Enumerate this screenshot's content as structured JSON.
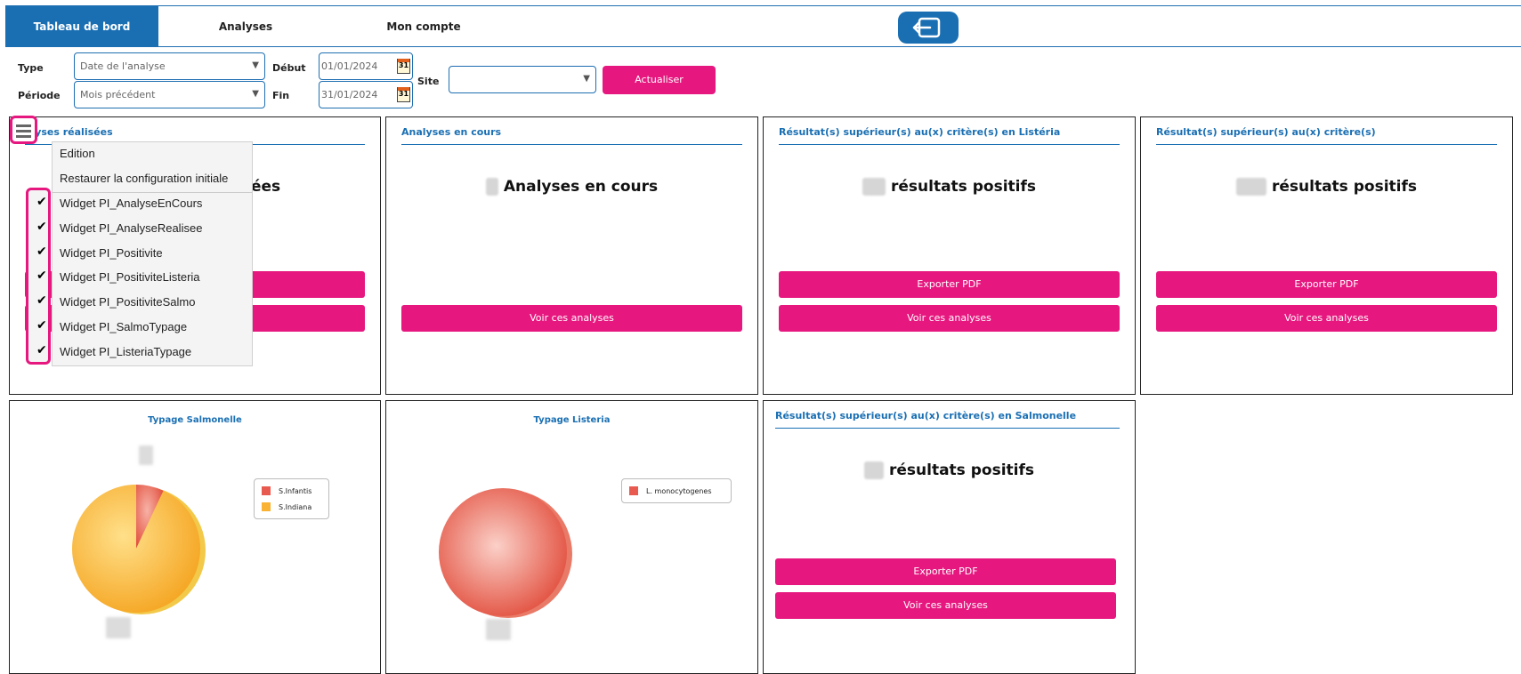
{
  "nav": {
    "tabs": [
      "Tableau de bord",
      "Analyses",
      "Mon compte"
    ],
    "logout_icon": "logout-icon"
  },
  "filters": {
    "type_label": "Type",
    "type_value": "Date de l'analyse",
    "periode_label": "Période",
    "periode_value": "Mois précédent",
    "debut_label": "Début",
    "debut_value": "01/01/2024",
    "fin_label": "Fin",
    "fin_value": "31/01/2024",
    "calendar_day": "31",
    "site_label": "Site",
    "site_value": "",
    "refresh_label": "Actualiser"
  },
  "widgets": {
    "realisees": {
      "title": "alyses réalisées",
      "text": "isées"
    },
    "en_cours": {
      "title": "Analyses en cours",
      "text": "Analyses en cours",
      "button": "Voir ces analyses"
    },
    "listeria_pos": {
      "title": "Résultat(s) supérieur(s) au(x) critère(s) en Listéria",
      "text": "résultats positifs",
      "export": "Exporter PDF",
      "voir": "Voir ces analyses"
    },
    "positifs": {
      "title": "Résultat(s) supérieur(s) au(x) critère(s)",
      "text": "résultats positifs",
      "export": "Exporter PDF",
      "voir": "Voir ces analyses"
    },
    "salmo_pos": {
      "title": "Résultat(s) supérieur(s) au(x) critère(s) en Salmonelle",
      "text": "résultats positifs",
      "export": "Exporter PDF",
      "voir": "Voir ces analyses"
    }
  },
  "charts": {
    "salmo": {
      "title": "Typage Salmonelle",
      "legend": [
        "S.Infantis",
        "S.Indiana"
      ]
    },
    "listeria": {
      "title": "Typage Listeria",
      "legend": [
        "L. monocytogenes"
      ]
    }
  },
  "chart_data": [
    {
      "type": "pie",
      "title": "Typage Salmonelle",
      "categories": [
        "S.Infantis",
        "S.Indiana"
      ],
      "values": [
        7,
        93
      ],
      "colors": [
        "#e85a4f",
        "#f9b233"
      ]
    },
    {
      "type": "pie",
      "title": "Typage Listeria",
      "categories": [
        "L. monocytogenes"
      ],
      "values": [
        100
      ],
      "colors": [
        "#e85a4f"
      ]
    }
  ],
  "menu": {
    "items": [
      "Edition",
      "Restaurer la configuration initiale",
      "Widget PI_AnalyseEnCours",
      "Widget PI_AnalyseRealisee",
      "Widget PI_Positivite",
      "Widget PI_PositiviteListeria",
      "Widget PI_PositiviteSalmo",
      "Widget PI_SalmoTypage",
      "Widget PI_ListeriaTypage"
    ],
    "check": "✔"
  },
  "colors": {
    "primary": "#1a6fb3",
    "accent": "#e6177f"
  }
}
